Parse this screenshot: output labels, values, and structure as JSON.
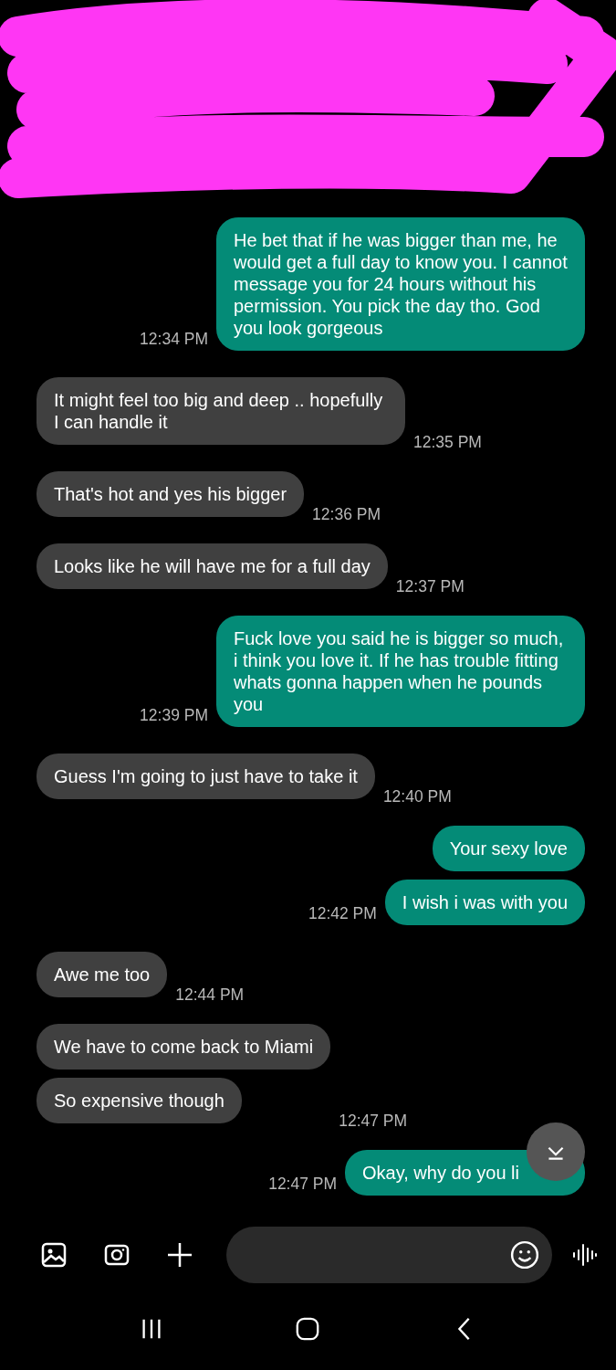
{
  "header": {
    "redacted": true
  },
  "messages": [
    {
      "kind": "sent",
      "texts": [
        "He bet that if he was bigger than me, he would get a full day to know you. I cannot message you for 24 hours without his permission. You pick the day tho. God you look gorgeous"
      ],
      "time": "12:34 PM"
    },
    {
      "kind": "received",
      "texts": [
        "It might feel too big and deep .. hopefully I can handle it"
      ],
      "time": "12:35 PM"
    },
    {
      "kind": "received",
      "texts": [
        "That's hot and yes his bigger"
      ],
      "time": "12:36 PM"
    },
    {
      "kind": "received",
      "texts": [
        "Looks like he will have me for a full day"
      ],
      "time": "12:37 PM"
    },
    {
      "kind": "sent",
      "texts": [
        "Fuck love you said he is bigger so much, i think you love it. If he has trouble fitting whats gonna happen when he pounds you"
      ],
      "time": "12:39 PM"
    },
    {
      "kind": "received",
      "texts": [
        "Guess I'm going to just have to take it"
      ],
      "time": "12:40 PM"
    },
    {
      "kind": "sent",
      "texts": [
        "Your sexy love",
        "I wish i was with you"
      ],
      "time": "12:42 PM"
    },
    {
      "kind": "received",
      "texts": [
        "Awe me too"
      ],
      "time": "12:44 PM"
    },
    {
      "kind": "received",
      "texts": [
        "We have to come back to Miami",
        "So expensive though"
      ],
      "time": "12:47 PM"
    },
    {
      "kind": "sent",
      "texts": [
        "Okay, why do you li"
      ],
      "time": "12:47 PM"
    }
  ],
  "scroll_down_button": true
}
